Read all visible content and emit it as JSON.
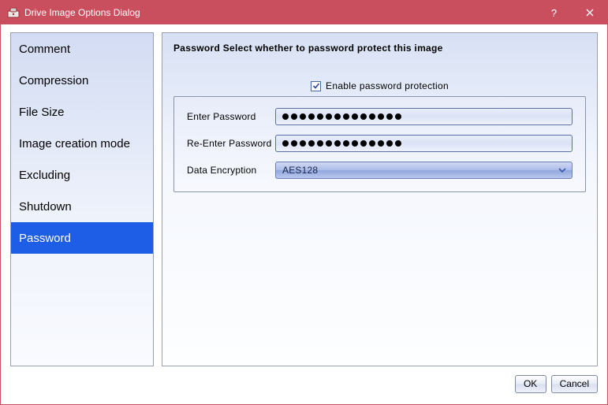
{
  "window": {
    "title": "Drive Image Options Dialog"
  },
  "sidebar": {
    "items": [
      {
        "label": "Comment",
        "selected": false
      },
      {
        "label": "Compression",
        "selected": false
      },
      {
        "label": "File Size",
        "selected": false
      },
      {
        "label": "Image creation mode",
        "selected": false
      },
      {
        "label": "Excluding",
        "selected": false
      },
      {
        "label": "Shutdown",
        "selected": false
      },
      {
        "label": "Password",
        "selected": true
      }
    ]
  },
  "content": {
    "heading": "Password Select whether to password protect this image",
    "enable_label": "Enable password protection",
    "enable_checked": true,
    "rows": {
      "enter_label": "Enter Password",
      "enter_value": "••••••••••••••",
      "reenter_label": "Re-Enter Password",
      "reenter_value": "••••••••••••••",
      "encryption_label": "Data Encryption",
      "encryption_value": "AES128"
    },
    "password_dot_count": 14
  },
  "footer": {
    "ok": "OK",
    "cancel": "Cancel"
  }
}
